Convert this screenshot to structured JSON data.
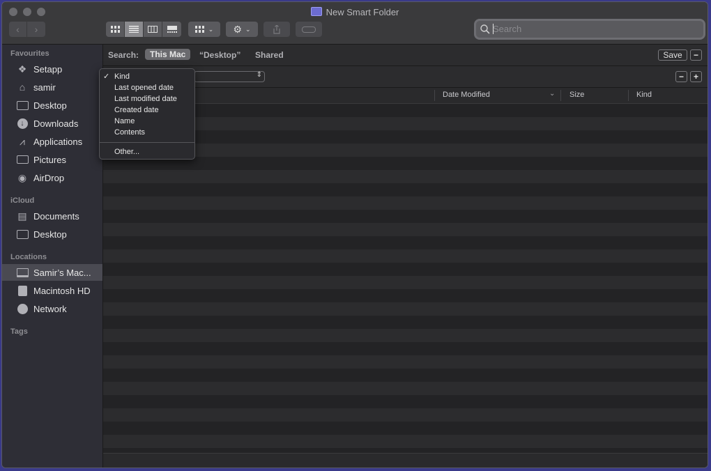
{
  "window": {
    "title": "New Smart Folder"
  },
  "toolbar": {
    "back_icon": "chevron-left-icon",
    "forward_icon": "chevron-right-icon",
    "view_modes": [
      "icon-view-icon",
      "list-view-icon",
      "column-view-icon",
      "gallery-view-icon"
    ],
    "search_placeholder": "Search"
  },
  "sidebar": {
    "favourites_header": "Favourites",
    "favourites": [
      {
        "label": "Setapp",
        "icon": "setapp-icon"
      },
      {
        "label": "samir",
        "icon": "home-icon"
      },
      {
        "label": "Desktop",
        "icon": "desktop-folder-icon"
      },
      {
        "label": "Downloads",
        "icon": "downloads-icon"
      },
      {
        "label": "Applications",
        "icon": "applications-icon"
      },
      {
        "label": "Pictures",
        "icon": "camera-icon"
      },
      {
        "label": "AirDrop",
        "icon": "airdrop-icon"
      }
    ],
    "icloud_header": "iCloud",
    "icloud": [
      {
        "label": "Documents",
        "icon": "documents-icon"
      },
      {
        "label": "Desktop",
        "icon": "desktop-folder-icon"
      }
    ],
    "locations_header": "Locations",
    "locations": [
      {
        "label": "Samir’s Mac...",
        "icon": "laptop-icon"
      },
      {
        "label": "Macintosh HD",
        "icon": "hard-drive-icon"
      },
      {
        "label": "Network",
        "icon": "network-icon"
      }
    ],
    "tags_header": "Tags"
  },
  "scope": {
    "label": "Search:",
    "this_mac": "This Mac",
    "desktop": "“Desktop”",
    "shared": "Shared",
    "save": "Save",
    "minus": "−"
  },
  "criteria": {
    "minus": "−",
    "plus": "+"
  },
  "columns": {
    "date_modified": "Date Modified",
    "size": "Size",
    "kind": "Kind"
  },
  "menu": {
    "items": [
      "Kind",
      "Last opened date",
      "Last modified date",
      "Created date",
      "Name",
      "Contents"
    ],
    "checked": "Kind",
    "other": "Other..."
  }
}
